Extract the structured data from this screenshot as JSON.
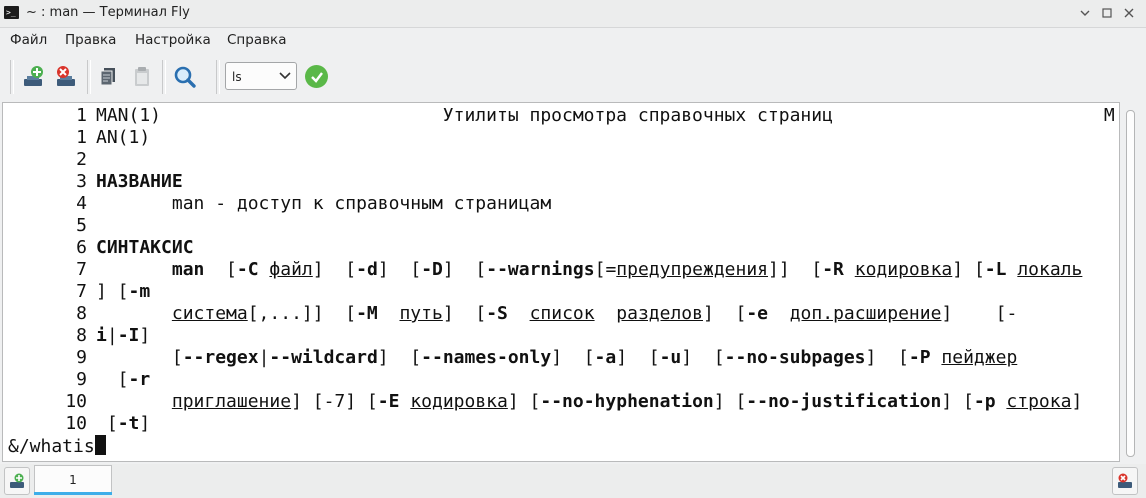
{
  "window": {
    "title": "~ : man — Терминал Fly"
  },
  "menu": [
    {
      "label": "Файл"
    },
    {
      "label": "Правка"
    },
    {
      "label": "Настройка"
    },
    {
      "label": "Справка"
    }
  ],
  "toolbar": {
    "combo_value": "ls",
    "icons": [
      "new-session-icon",
      "close-session-icon",
      "copy-icon",
      "paste-icon",
      "search-icon",
      "confirm-icon"
    ]
  },
  "terminal": {
    "lines": [
      [
        {
          "t": "MAN(1)"
        },
        {
          "t": "                          Утилиты просмотра справочных страниц                         M"
        }
      ],
      [
        {
          "t": "AN(1)"
        }
      ],
      [],
      [
        {
          "t": "НАЗВАНИЕ",
          "s": "b"
        }
      ],
      [
        {
          "t": "       man - доступ к справочным страницам"
        }
      ],
      [],
      [
        {
          "t": "СИНТАКСИС",
          "s": "b"
        }
      ],
      [
        {
          "t": "       "
        },
        {
          "t": "man",
          "s": "b"
        },
        {
          "t": "  ["
        },
        {
          "t": "-C",
          "s": "b"
        },
        {
          "t": " "
        },
        {
          "t": "файл",
          "s": "u"
        },
        {
          "t": "]  ["
        },
        {
          "t": "-d",
          "s": "b"
        },
        {
          "t": "]  ["
        },
        {
          "t": "-D",
          "s": "b"
        },
        {
          "t": "]  ["
        },
        {
          "t": "--warnings",
          "s": "b"
        },
        {
          "t": "[="
        },
        {
          "t": "предупреждения",
          "s": "u"
        },
        {
          "t": "]]  ["
        },
        {
          "t": "-R",
          "s": "b"
        },
        {
          "t": " "
        },
        {
          "t": "кодировка",
          "s": "u"
        },
        {
          "t": "] ["
        },
        {
          "t": "-L",
          "s": "b"
        },
        {
          "t": " "
        },
        {
          "t": "локаль",
          "s": "u"
        }
      ],
      [
        {
          "t": "] ["
        },
        {
          "t": "-m",
          "s": "b"
        }
      ],
      [
        {
          "t": "       "
        },
        {
          "t": "система",
          "s": "u"
        },
        {
          "t": "[,...]]  ["
        },
        {
          "t": "-M",
          "s": "b"
        },
        {
          "t": "  "
        },
        {
          "t": "путь",
          "s": "u"
        },
        {
          "t": "]  ["
        },
        {
          "t": "-S",
          "s": "b"
        },
        {
          "t": "  "
        },
        {
          "t": "список",
          "s": "u"
        },
        {
          "t": "  "
        },
        {
          "t": "разделов",
          "s": "u"
        },
        {
          "t": "]  ["
        },
        {
          "t": "-e",
          "s": "b"
        },
        {
          "t": "  "
        },
        {
          "t": "доп.расширение",
          "s": "u"
        },
        {
          "t": "]    [-"
        }
      ],
      [
        {
          "t": "i",
          "s": "b"
        },
        {
          "t": "|"
        },
        {
          "t": "-I",
          "s": "b"
        },
        {
          "t": "]"
        }
      ],
      [
        {
          "t": "       ["
        },
        {
          "t": "--regex",
          "s": "b"
        },
        {
          "t": "|"
        },
        {
          "t": "--wildcard",
          "s": "b"
        },
        {
          "t": "]  ["
        },
        {
          "t": "--names-only",
          "s": "b"
        },
        {
          "t": "]  ["
        },
        {
          "t": "-a",
          "s": "b"
        },
        {
          "t": "]  ["
        },
        {
          "t": "-u",
          "s": "b"
        },
        {
          "t": "]  ["
        },
        {
          "t": "--no-subpages",
          "s": "b"
        },
        {
          "t": "]  ["
        },
        {
          "t": "-P",
          "s": "b"
        },
        {
          "t": " "
        },
        {
          "t": "пейджер",
          "s": "u"
        }
      ],
      [
        {
          "t": "  ["
        },
        {
          "t": "-r",
          "s": "b"
        }
      ],
      [
        {
          "t": "       "
        },
        {
          "t": "приглашение",
          "s": "u"
        },
        {
          "t": "] [-7] ["
        },
        {
          "t": "-E",
          "s": "b"
        },
        {
          "t": " "
        },
        {
          "t": "кодировка",
          "s": "u"
        },
        {
          "t": "] ["
        },
        {
          "t": "--no-hyphenation",
          "s": "b"
        },
        {
          "t": "] ["
        },
        {
          "t": "--no-justification",
          "s": "b"
        },
        {
          "t": "] ["
        },
        {
          "t": "-p",
          "s": "b"
        },
        {
          "t": " "
        },
        {
          "t": "строка",
          "s": "u"
        },
        {
          "t": "]"
        }
      ],
      [
        {
          "t": " ["
        },
        {
          "t": "-t",
          "s": "b"
        },
        {
          "t": "]"
        }
      ]
    ],
    "line_numbers": [
      "1",
      "1",
      "2",
      "3",
      "4",
      "5",
      "6",
      "7",
      "7",
      "8",
      "8",
      "9",
      "9",
      "10",
      "10"
    ],
    "prompt": "&/whatis"
  },
  "tabs": [
    {
      "label": "1"
    }
  ]
}
